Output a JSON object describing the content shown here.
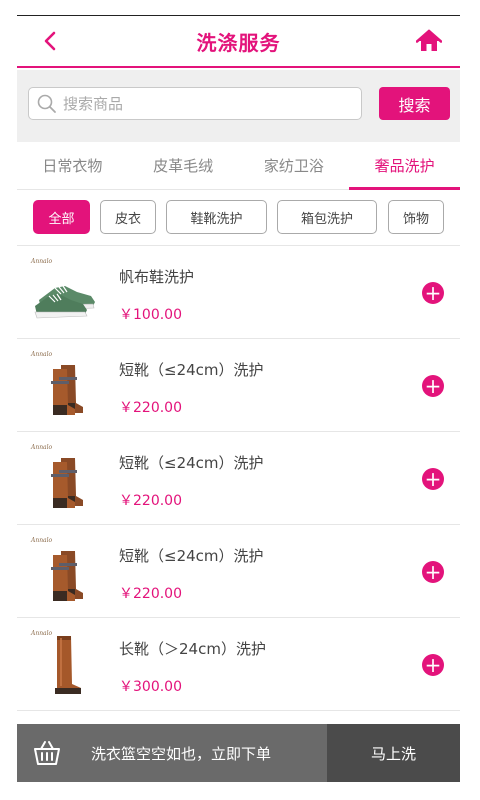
{
  "header": {
    "title": "洗涤服务",
    "back_icon": "chevron-left-icon",
    "home_icon": "home-icon"
  },
  "search": {
    "placeholder": "搜索商品",
    "value": "",
    "button_label": "搜索",
    "icon": "search-icon"
  },
  "tabs": [
    {
      "label": "日常衣物",
      "active": false
    },
    {
      "label": "皮革毛绒",
      "active": false
    },
    {
      "label": "家纺卫浴",
      "active": false
    },
    {
      "label": "奢品洗护",
      "active": true
    }
  ],
  "filters": [
    {
      "label": "全部",
      "active": true
    },
    {
      "label": "皮衣",
      "active": false
    },
    {
      "label": "鞋靴洗护",
      "active": false
    },
    {
      "label": "箱包洗护",
      "active": false
    },
    {
      "label": "饰物",
      "active": false
    }
  ],
  "products": [
    {
      "name": "帆布鞋洗护",
      "price": "￥100.00",
      "image": "sneaker"
    },
    {
      "name": "短靴（≤24cm）洗护",
      "price": "￥220.00",
      "image": "short-boots"
    },
    {
      "name": "短靴（≤24cm）洗护",
      "price": "￥220.00",
      "image": "short-boots"
    },
    {
      "name": "短靴（≤24cm）洗护",
      "price": "￥220.00",
      "image": "short-boots"
    },
    {
      "name": "长靴（＞24cm）洗护",
      "price": "￥300.00",
      "image": "tall-boot"
    }
  ],
  "cart": {
    "empty_text": "洗衣篮空空如也，立即下单",
    "button_label": "马上洗",
    "icon": "basket-icon"
  },
  "colors": {
    "accent": "#e3137b",
    "cart_bg": "#6a6a6a",
    "cart_button_bg": "#4b4b4b"
  }
}
